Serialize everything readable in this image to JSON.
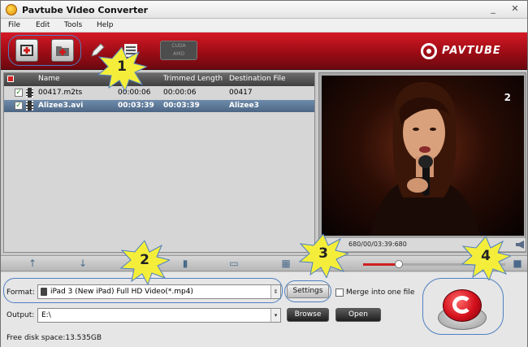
{
  "window": {
    "title": "Pavtube Video Converter",
    "minimize": "_",
    "close": "✕"
  },
  "menu": [
    "File",
    "Edit",
    "Tools",
    "Help"
  ],
  "toolbar": {
    "cuda_label": "CUDA",
    "amd_label": "AMD",
    "brand": "PAVTUBE"
  },
  "file_list": {
    "columns": [
      "Name",
      "Trimmed Length",
      "Destination File"
    ],
    "rows": [
      {
        "name": "00417.m2ts",
        "duration": "00:00:06",
        "trimmed_length": "00:00:06",
        "destination": "00417",
        "checked": true,
        "selected": false
      },
      {
        "name": "Alizee3.avi",
        "duration": "00:03:39",
        "trimmed_length": "00:03:39",
        "destination": "Alizee3",
        "checked": true,
        "selected": true
      }
    ]
  },
  "preview": {
    "channel_logo": "2",
    "time": "680/00/03:39:680"
  },
  "format": {
    "label": "Format:",
    "value": "iPad 3 (New iPad) Full HD Video(*.mp4)",
    "settings_label": "Settings",
    "merge_label": "Merge into one file"
  },
  "output": {
    "label": "Output:",
    "value": "E:\\",
    "browse_label": "Browse",
    "open_label": "Open"
  },
  "status": {
    "free_disk": "Free disk space:13.535GB"
  },
  "callouts": [
    "1",
    "2",
    "3",
    "4"
  ],
  "colors": {
    "toolbar_red": "#c2121d",
    "selection_blue": "#5a7596",
    "callout_yellow": "#f4ee3a",
    "callout_outline": "#4f7fc1"
  }
}
